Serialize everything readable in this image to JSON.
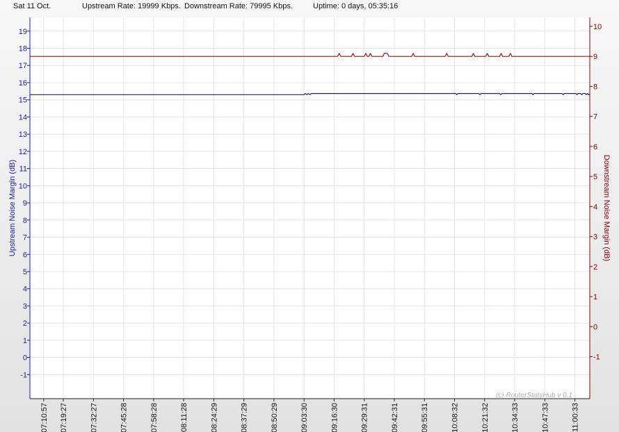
{
  "header": {
    "date": "Sat 11 Oct.",
    "upstream_rate": "Upstream Rate: 19999 Kbps.",
    "downstream_rate": "Downstream Rate: 79995 Kbps.",
    "uptime": "Uptime: 0 days, 05:35:16"
  },
  "colors": {
    "upstream": "#1a1aa8",
    "downstream": "#8b0000",
    "upstream_line": "#1f2a4a",
    "downstream_line": "#8b1a1a",
    "grid": "#e4e4e4"
  },
  "chart_data": {
    "type": "line",
    "title": "",
    "watermark": "(c) RouterStatsHub v 0.1",
    "ylabel_left": "Upstream Noise Margin (dB)",
    "ylabel_right": "Downstream Noise Margin (dB)",
    "ylim_left": [
      -2.4,
      19.8
    ],
    "yticks_left": [
      19,
      18,
      17,
      16,
      15,
      14,
      13,
      12,
      11,
      10,
      9,
      8,
      7,
      6,
      5,
      4,
      3,
      2,
      1,
      0,
      -1
    ],
    "ylim_right": [
      -2.4,
      10.3
    ],
    "yticks_right": [
      10,
      9,
      8,
      7,
      6,
      5,
      4,
      3,
      2,
      1,
      0,
      -1
    ],
    "grid": true,
    "x_tick_labels": [
      "07:10:57",
      "07:19:27",
      "07:32:27",
      "07:45:28",
      "07:58:28",
      "08:11:28",
      "08:24:29",
      "08:37:29",
      "08:50:29",
      "09:03:30",
      "09:16:30",
      "09:29:31",
      "09:42:31",
      "09:55:31",
      "10:08:32",
      "10:21:32",
      "10:34:33",
      "10:47:33",
      "11:00:33"
    ],
    "xlim": [
      "07:05:00",
      "11:07:00"
    ],
    "series": [
      {
        "axis": "left",
        "points": [
          [
            "07:05:00",
            15.3
          ],
          [
            "09:03:30",
            15.3
          ],
          [
            "09:04:00",
            15.37
          ],
          [
            "09:04:40",
            15.3
          ],
          [
            "09:05:20",
            15.37
          ],
          [
            "09:06:00",
            15.3
          ],
          [
            "09:06:40",
            15.37
          ],
          [
            "09:07:20",
            15.37
          ],
          [
            "10:09:00",
            15.37
          ],
          [
            "10:09:30",
            15.3
          ],
          [
            "10:10:00",
            15.37
          ],
          [
            "10:19:00",
            15.37
          ],
          [
            "10:19:30",
            15.3
          ],
          [
            "10:20:00",
            15.37
          ],
          [
            "10:28:00",
            15.37
          ],
          [
            "10:28:30",
            15.3
          ],
          [
            "10:29:00",
            15.37
          ],
          [
            "10:42:00",
            15.37
          ],
          [
            "10:42:30",
            15.3
          ],
          [
            "10:43:00",
            15.37
          ],
          [
            "10:55:00",
            15.37
          ],
          [
            "10:55:30",
            15.3
          ],
          [
            "10:56:00",
            15.37
          ],
          [
            "11:01:00",
            15.37
          ],
          [
            "11:01:30",
            15.3
          ],
          [
            "11:02:00",
            15.37
          ],
          [
            "11:03:00",
            15.37
          ],
          [
            "11:03:30",
            15.3
          ],
          [
            "11:04:00",
            15.37
          ],
          [
            "11:05:00",
            15.37
          ],
          [
            "11:05:30",
            15.3
          ],
          [
            "11:06:00",
            15.37
          ],
          [
            "11:06:30",
            15.3
          ],
          [
            "11:07:00",
            15.3
          ]
        ]
      },
      {
        "axis": "right",
        "points": [
          [
            "07:05:00",
            9.0
          ],
          [
            "09:18:00",
            9.0
          ],
          [
            "09:18:40",
            9.1
          ],
          [
            "09:19:20",
            9.0
          ],
          [
            "09:24:00",
            9.0
          ],
          [
            "09:24:40",
            9.1
          ],
          [
            "09:25:20",
            9.0
          ],
          [
            "09:29:30",
            9.0
          ],
          [
            "09:30:10",
            9.1
          ],
          [
            "09:30:50",
            9.0
          ],
          [
            "09:31:30",
            9.0
          ],
          [
            "09:32:10",
            9.1
          ],
          [
            "09:32:50",
            9.0
          ],
          [
            "09:37:30",
            9.0
          ],
          [
            "09:38:10",
            9.1
          ],
          [
            "09:39:30",
            9.1
          ],
          [
            "09:40:10",
            9.0
          ],
          [
            "09:50:00",
            9.0
          ],
          [
            "09:50:40",
            9.1
          ],
          [
            "09:51:20",
            9.0
          ],
          [
            "10:04:30",
            9.0
          ],
          [
            "10:05:10",
            9.1
          ],
          [
            "10:05:50",
            9.0
          ],
          [
            "10:16:00",
            9.0
          ],
          [
            "10:16:40",
            9.1
          ],
          [
            "10:17:20",
            9.0
          ],
          [
            "10:22:00",
            9.0
          ],
          [
            "10:22:40",
            9.1
          ],
          [
            "10:23:20",
            9.0
          ],
          [
            "10:28:00",
            9.0
          ],
          [
            "10:28:40",
            9.1
          ],
          [
            "10:29:20",
            9.0
          ],
          [
            "10:32:00",
            9.0
          ],
          [
            "10:32:40",
            9.1
          ],
          [
            "10:33:20",
            9.0
          ],
          [
            "11:07:00",
            9.0
          ]
        ]
      }
    ]
  }
}
